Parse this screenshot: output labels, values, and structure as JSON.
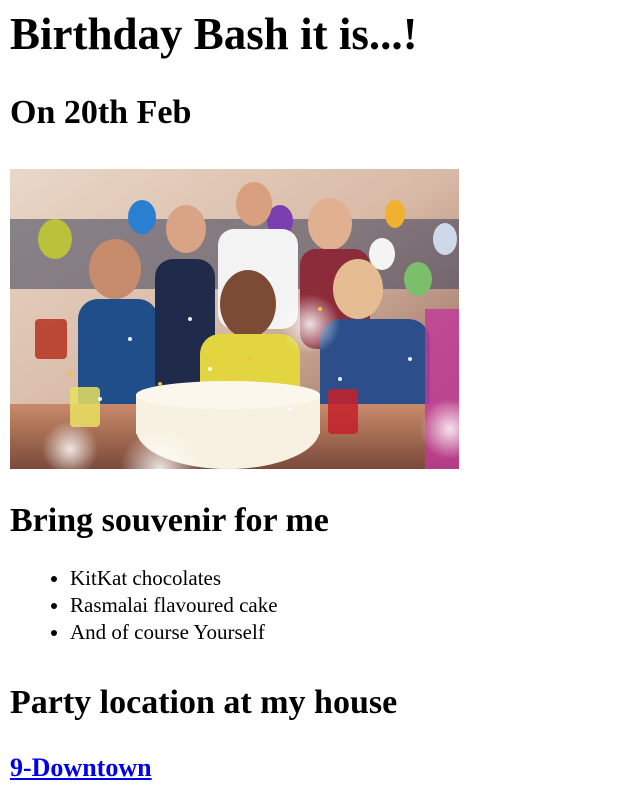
{
  "page": {
    "title": "Birthday Bash it is...!",
    "date_heading": "On 20th Feb"
  },
  "image": {
    "alt": "Group of friends celebrating with a birthday cake, balloons and confetti"
  },
  "souvenir": {
    "heading": "Bring souvenir for me",
    "items": [
      "KitKat chocolates",
      "Rasmalai flavoured cake",
      "And of course Yourself"
    ]
  },
  "location": {
    "heading": "Party location at my house",
    "link_text": "9-Downtown"
  },
  "colors": {
    "link": "#0000ee",
    "text": "#000000"
  }
}
